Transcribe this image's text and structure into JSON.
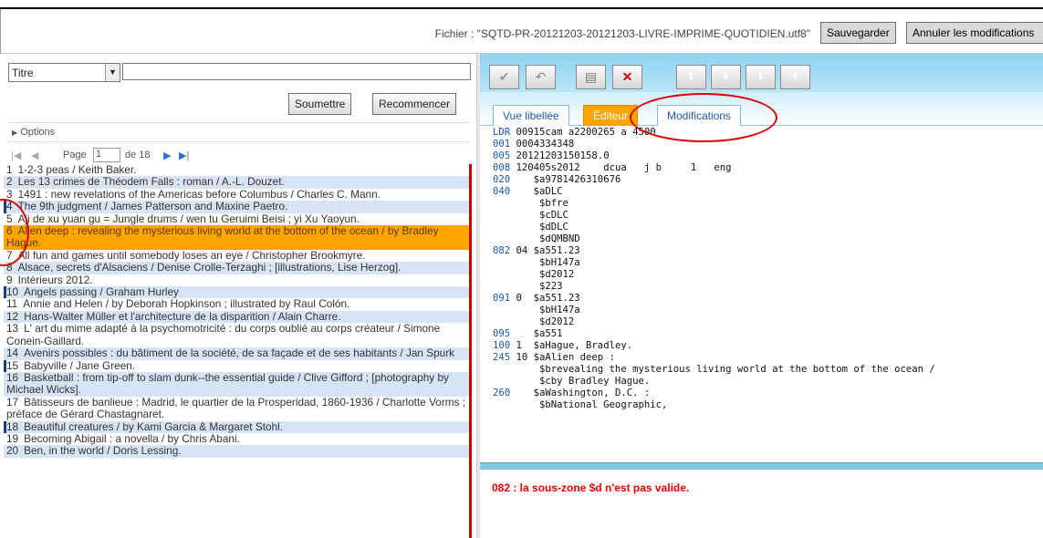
{
  "header": {
    "file_label": "Fichier : \"SQTD-PR-20121203-20121203-LIVRE-IMPRIME-QUOTIDIEN.utf8\"",
    "save_label": "Sauvegarder",
    "cancel_label": "Annuler les modifications"
  },
  "search": {
    "field_selected": "Titre",
    "query": "",
    "submit_label": "Soumettre",
    "reset_label": "Recommencer"
  },
  "options_label": "Options",
  "pager": {
    "page_label": "Page",
    "page_value": "1",
    "of_label": "de 18"
  },
  "results": [
    {
      "n": "1",
      "text": "1-2-3 peas / Keith Baker."
    },
    {
      "n": "2",
      "text": "Les 13 crimes de Théodem Falls : roman / A.-L. Douzet."
    },
    {
      "n": "3",
      "text": "1491 : new revelations of the Americas before Columbus / Charles C. Mann."
    },
    {
      "n": "4",
      "text": "The 9th judgment / James Patterson and Maxine Paetro."
    },
    {
      "n": "5",
      "text": "Aji de xu yuan gu = Jungle drums / wen tu Geruimi Beisi ; yi Xu Yaoyun."
    },
    {
      "n": "6",
      "text": "Alien deep : revealing the mysterious living world at the bottom of the ocean / by Bradley Hague."
    },
    {
      "n": "7",
      "text": "All fun and games until somebody loses an eye / Christopher Brookmyre."
    },
    {
      "n": "8",
      "text": "Alsace, secrets d'Alsaciens / Denise Crolle-Terzaghi ; [illustrations, Lise Herzog]."
    },
    {
      "n": "9",
      "text": "Intérieurs 2012."
    },
    {
      "n": "10",
      "text": "Angels passing / Graham Hurley"
    },
    {
      "n": "11",
      "text": "Annie and Helen / by Deborah Hopkinson ; illustrated by Raul Colón."
    },
    {
      "n": "12",
      "text": "Hans-Walter Müller et l'architecture de la disparition / Alain Charre."
    },
    {
      "n": "13",
      "text": "L' art du mime adapté à la psychomotricité : du corps oublié au corps créateur / Simone Conein-Gaillard."
    },
    {
      "n": "14",
      "text": "Avenirs possibles : du bâtiment de la société, de sa façade et de ses habitants / Jan Spurk"
    },
    {
      "n": "15",
      "text": "Babyville / Jane Green."
    },
    {
      "n": "16",
      "text": "Basketball : from tip-off to slam dunk--the essential guide / Clive Gifford ; [photography by Michael Wicks]."
    },
    {
      "n": "17",
      "text": "Bâtisseurs de banlieue : Madrid, le quartier de la Prosperidad, 1860-1936 / Charlotte Vorms ; préface de Gérard Chastagnaret."
    },
    {
      "n": "18",
      "text": "Beautiful creatures / by Kami Garcia & Margaret Stohl."
    },
    {
      "n": "19",
      "text": "Becoming Abigail : a novella / by Chris Abani."
    },
    {
      "n": "20",
      "text": "Ben, in the world / Doris Lessing."
    }
  ],
  "tabs": {
    "vue": "Vue libellée",
    "editeur": "Éditeur",
    "modifications": "Modifications"
  },
  "marc": [
    {
      "tag": "LDR",
      "rest": " 00915cam a2200265 a 4500"
    },
    {
      "tag": "001",
      "rest": " 0004334348"
    },
    {
      "tag": "005",
      "rest": " 20121203150158.0"
    },
    {
      "tag": "008",
      "rest": " 120405s2012    dcua   j b     1   eng"
    },
    {
      "tag": "020",
      "rest": "    $a9781426310676"
    },
    {
      "tag": "040",
      "rest": "    $aDLC"
    },
    {
      "tag": "",
      "rest": "        $bfre"
    },
    {
      "tag": "",
      "rest": "        $cDLC"
    },
    {
      "tag": "",
      "rest": "        $dDLC"
    },
    {
      "tag": "",
      "rest": "        $dQMBND"
    },
    {
      "tag": "082",
      "rest": " 04 $a551.23"
    },
    {
      "tag": "",
      "rest": "        $bH147a"
    },
    {
      "tag": "",
      "rest": "        $d2012"
    },
    {
      "tag": "",
      "rest": "        $223"
    },
    {
      "tag": "091",
      "rest": " 0  $a551.23"
    },
    {
      "tag": "",
      "rest": "        $bH147a"
    },
    {
      "tag": "",
      "rest": "        $d2012"
    },
    {
      "tag": "095",
      "rest": "    $a551"
    },
    {
      "tag": "100",
      "rest": " 1  $aHague, Bradley."
    },
    {
      "tag": "245",
      "rest": " 10 $aAlien deep :"
    },
    {
      "tag": "",
      "rest": "        $brevealing the mysterious living world at the bottom of the ocean /"
    },
    {
      "tag": "",
      "rest": "        $cby Bradley Hague."
    },
    {
      "tag": "260",
      "rest": "    $aWashington, D.C. :"
    },
    {
      "tag": "",
      "rest": "        $bNational Geographic,"
    }
  ],
  "error_message": "082 : la sous-zone $d n'est pas valide."
}
